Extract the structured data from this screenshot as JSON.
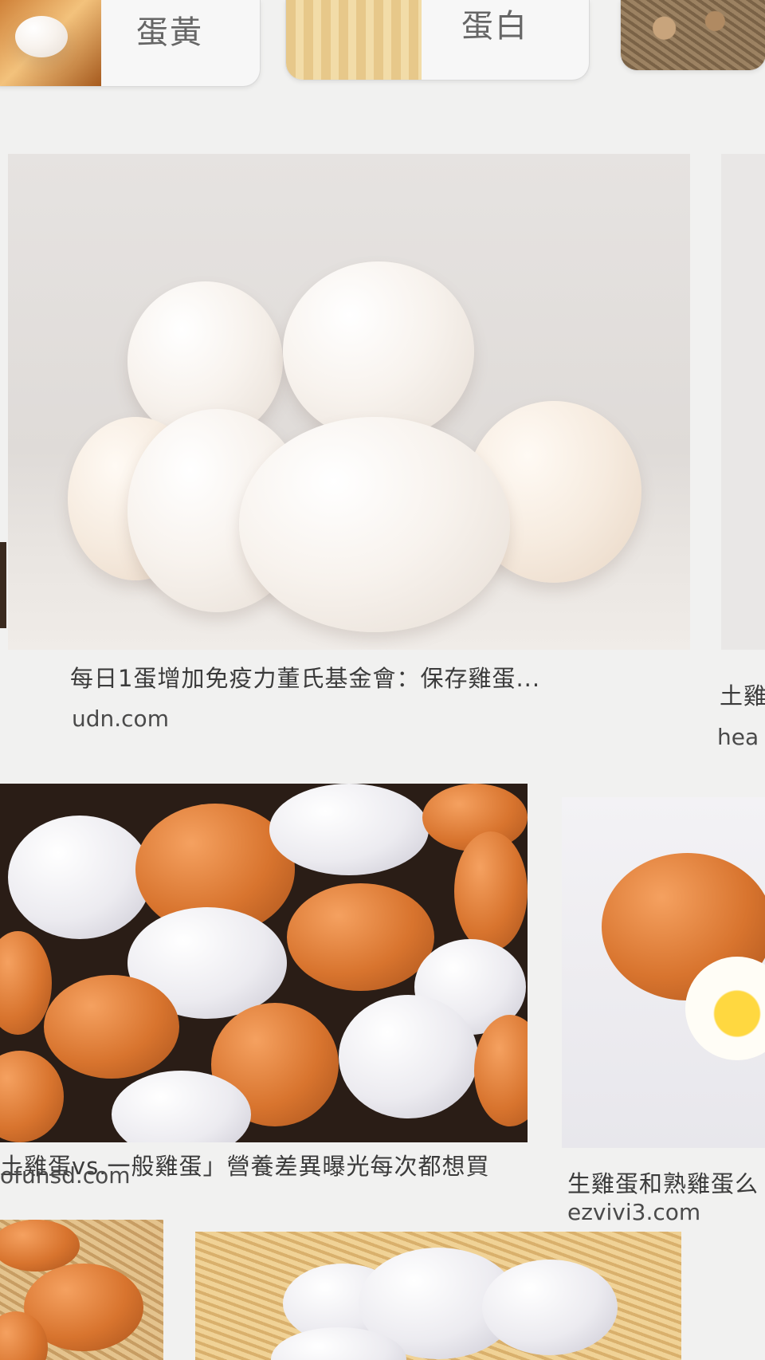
{
  "chips": [
    {
      "label": "蛋黃"
    },
    {
      "label": "蛋白"
    }
  ],
  "results": [
    {
      "title": "每日1蛋增加免疫力董氏基金會：保存雞蛋...",
      "source": "udn.com"
    },
    {
      "title": "土雞",
      "source": "hea"
    },
    {
      "title": "土雞蛋vs.一般雞蛋」營養差異曝光每次都想買",
      "source": "ofunsd.com"
    },
    {
      "title": "生雞蛋和熟雞蛋么",
      "source": "ezvivi3.com"
    }
  ],
  "colors": {
    "page_bg": "#f1f1f0",
    "title_text": "#3b3b3b",
    "source_text": "#4a4a4a"
  }
}
